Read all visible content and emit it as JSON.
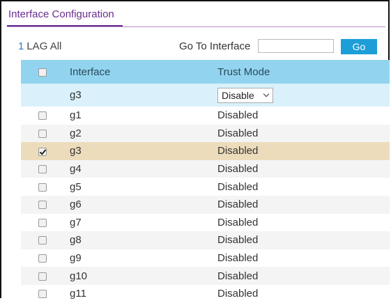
{
  "page": {
    "title": "Interface Configuration"
  },
  "filter": {
    "lag_number": "1",
    "lag_label": "LAG All"
  },
  "goto": {
    "label": "Go To Interface",
    "value": "",
    "button": "Go"
  },
  "table": {
    "headers": {
      "interface": "Interface",
      "trust_mode": "Trust Mode"
    },
    "edit_row": {
      "interface": "g3",
      "trust_mode_selected": "Disable"
    },
    "rows": [
      {
        "interface": "g1",
        "trust_mode": "Disabled",
        "checked": false
      },
      {
        "interface": "g2",
        "trust_mode": "Disabled",
        "checked": false
      },
      {
        "interface": "g3",
        "trust_mode": "Disabled",
        "checked": true
      },
      {
        "interface": "g4",
        "trust_mode": "Disabled",
        "checked": false
      },
      {
        "interface": "g5",
        "trust_mode": "Disabled",
        "checked": false
      },
      {
        "interface": "g6",
        "trust_mode": "Disabled",
        "checked": false
      },
      {
        "interface": "g7",
        "trust_mode": "Disabled",
        "checked": false
      },
      {
        "interface": "g8",
        "trust_mode": "Disabled",
        "checked": false
      },
      {
        "interface": "g9",
        "trust_mode": "Disabled",
        "checked": false
      },
      {
        "interface": "g10",
        "trust_mode": "Disabled",
        "checked": false
      },
      {
        "interface": "g11",
        "trust_mode": "Disabled",
        "checked": false
      }
    ]
  },
  "colors": {
    "accent": "#6b2c91",
    "header_bg": "#92d4ef",
    "selected_bg": "#eddcbc",
    "button": "#1d9ed8"
  }
}
